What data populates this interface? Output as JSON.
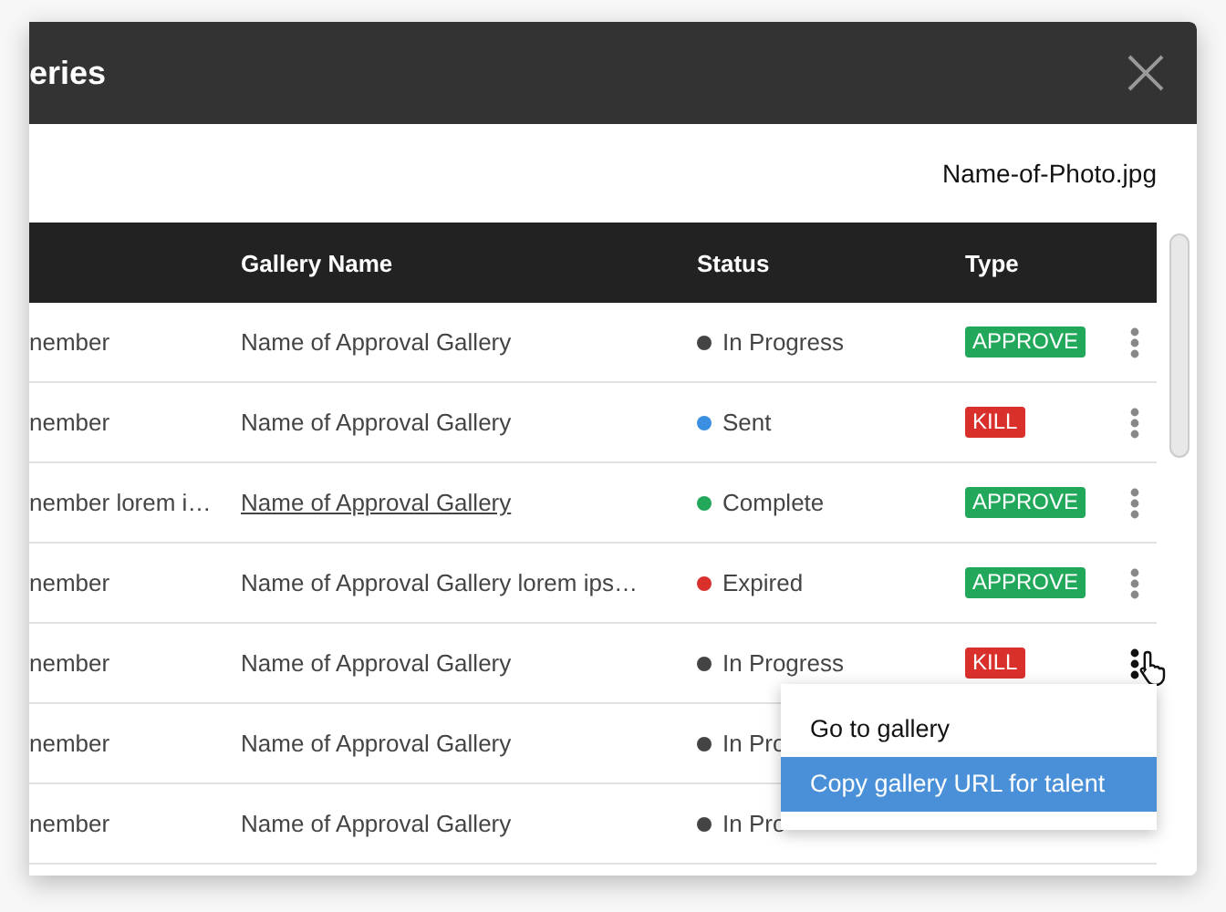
{
  "dialog": {
    "title": "eries",
    "file_name": "Name-of-Photo.jpg"
  },
  "table": {
    "columns": [
      "Gallery Name",
      "Status",
      "Type"
    ],
    "rows": [
      {
        "column_1": "nember",
        "gallery": "Name of Approval Gallery",
        "linked": false,
        "status": "In Progress",
        "color": "#444444",
        "type": "APPROVE",
        "kind": "approve",
        "actions": true,
        "menu_open": false
      },
      {
        "column_1": "nember",
        "gallery": "Name of Approval Gallery",
        "linked": false,
        "status": "Sent",
        "color": "#3b8fe0",
        "type": "KILL",
        "kind": "kill",
        "actions": true,
        "menu_open": false
      },
      {
        "column_1": "nember lorem i…",
        "gallery": "Name of Approval Gallery",
        "linked": true,
        "status": "Complete",
        "color": "#22a85a",
        "type": "APPROVE",
        "kind": "approve",
        "actions": true,
        "menu_open": false
      },
      {
        "column_1": "nember",
        "gallery": "Name of Approval Gallery lorem ips…",
        "linked": false,
        "status": "Expired",
        "color": "#d9302c",
        "type": "APPROVE",
        "kind": "approve",
        "actions": true,
        "menu_open": false
      },
      {
        "column_1": "nember",
        "gallery": "Name of Approval Gallery",
        "linked": false,
        "status": "In Progress",
        "color": "#444444",
        "type": "KILL",
        "kind": "kill",
        "actions": true,
        "menu_open": true
      },
      {
        "column_1": "nember",
        "gallery": "Name of Approval Gallery",
        "linked": false,
        "status": "In Pro",
        "color": "#444444",
        "actions": false,
        "menu_open": false
      },
      {
        "column_1": "nember",
        "gallery": "Name of Approval Gallery",
        "linked": false,
        "status": "In Pro",
        "color": "#444444",
        "actions": false,
        "menu_open": false
      }
    ]
  },
  "context_menu": {
    "items": [
      {
        "label": "Go to gallery",
        "selected": false
      },
      {
        "label": "Copy gallery URL for talent",
        "selected": true
      }
    ]
  }
}
